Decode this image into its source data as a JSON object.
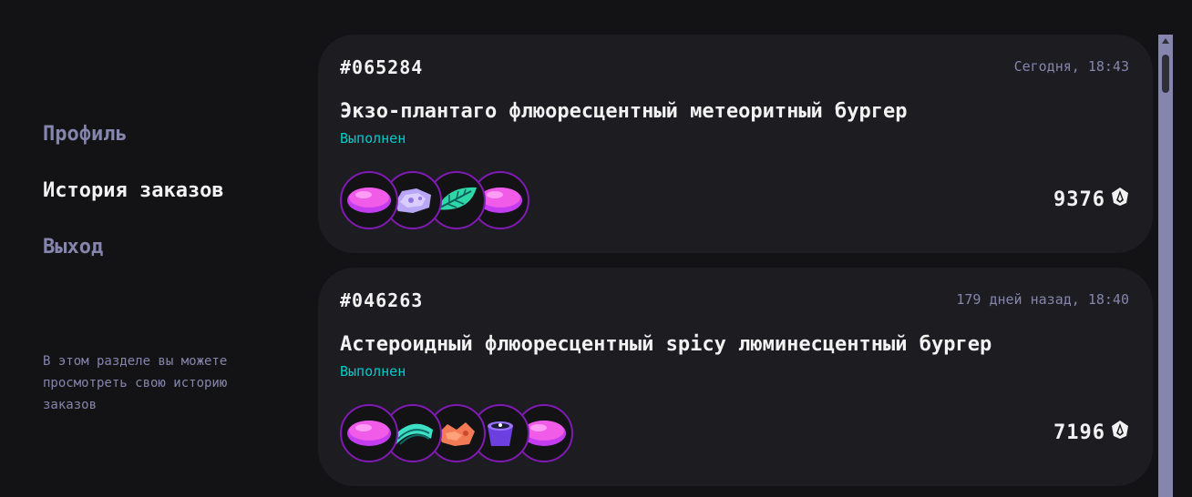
{
  "sidebar": {
    "items": [
      {
        "label": "Профиль",
        "active": false
      },
      {
        "label": "История заказов",
        "active": true
      },
      {
        "label": "Выход",
        "active": false
      }
    ],
    "note": "В этом разделе вы можете просмотреть свою историю заказов"
  },
  "orders": [
    {
      "number": "#065284",
      "time": "Сегодня, 18:43",
      "title": "Экзо-плантаго флюоресцентный метеоритный бургер",
      "status": "Выполнен",
      "price": "9376",
      "ingredients": [
        "bun-pink-icon",
        "meteor-meat-icon",
        "leaf-icon",
        "bun-pink-icon"
      ]
    },
    {
      "number": "#046263",
      "time": "179 дней назад, 18:40",
      "title": "Астероидный флюоресцентный spicy люминесцентный бургер",
      "status": "Выполнен",
      "price": "7196",
      "ingredients": [
        "bun-pink-icon",
        "mineral-rings-icon",
        "spicy-sauce-icon",
        "sauce-pot-icon",
        "bun-pink-icon"
      ]
    }
  ],
  "colors": {
    "background": "#131316",
    "card": "#1c1c21",
    "muted": "#8585ad",
    "status": "#00cccc",
    "ring": "#801ab3"
  }
}
